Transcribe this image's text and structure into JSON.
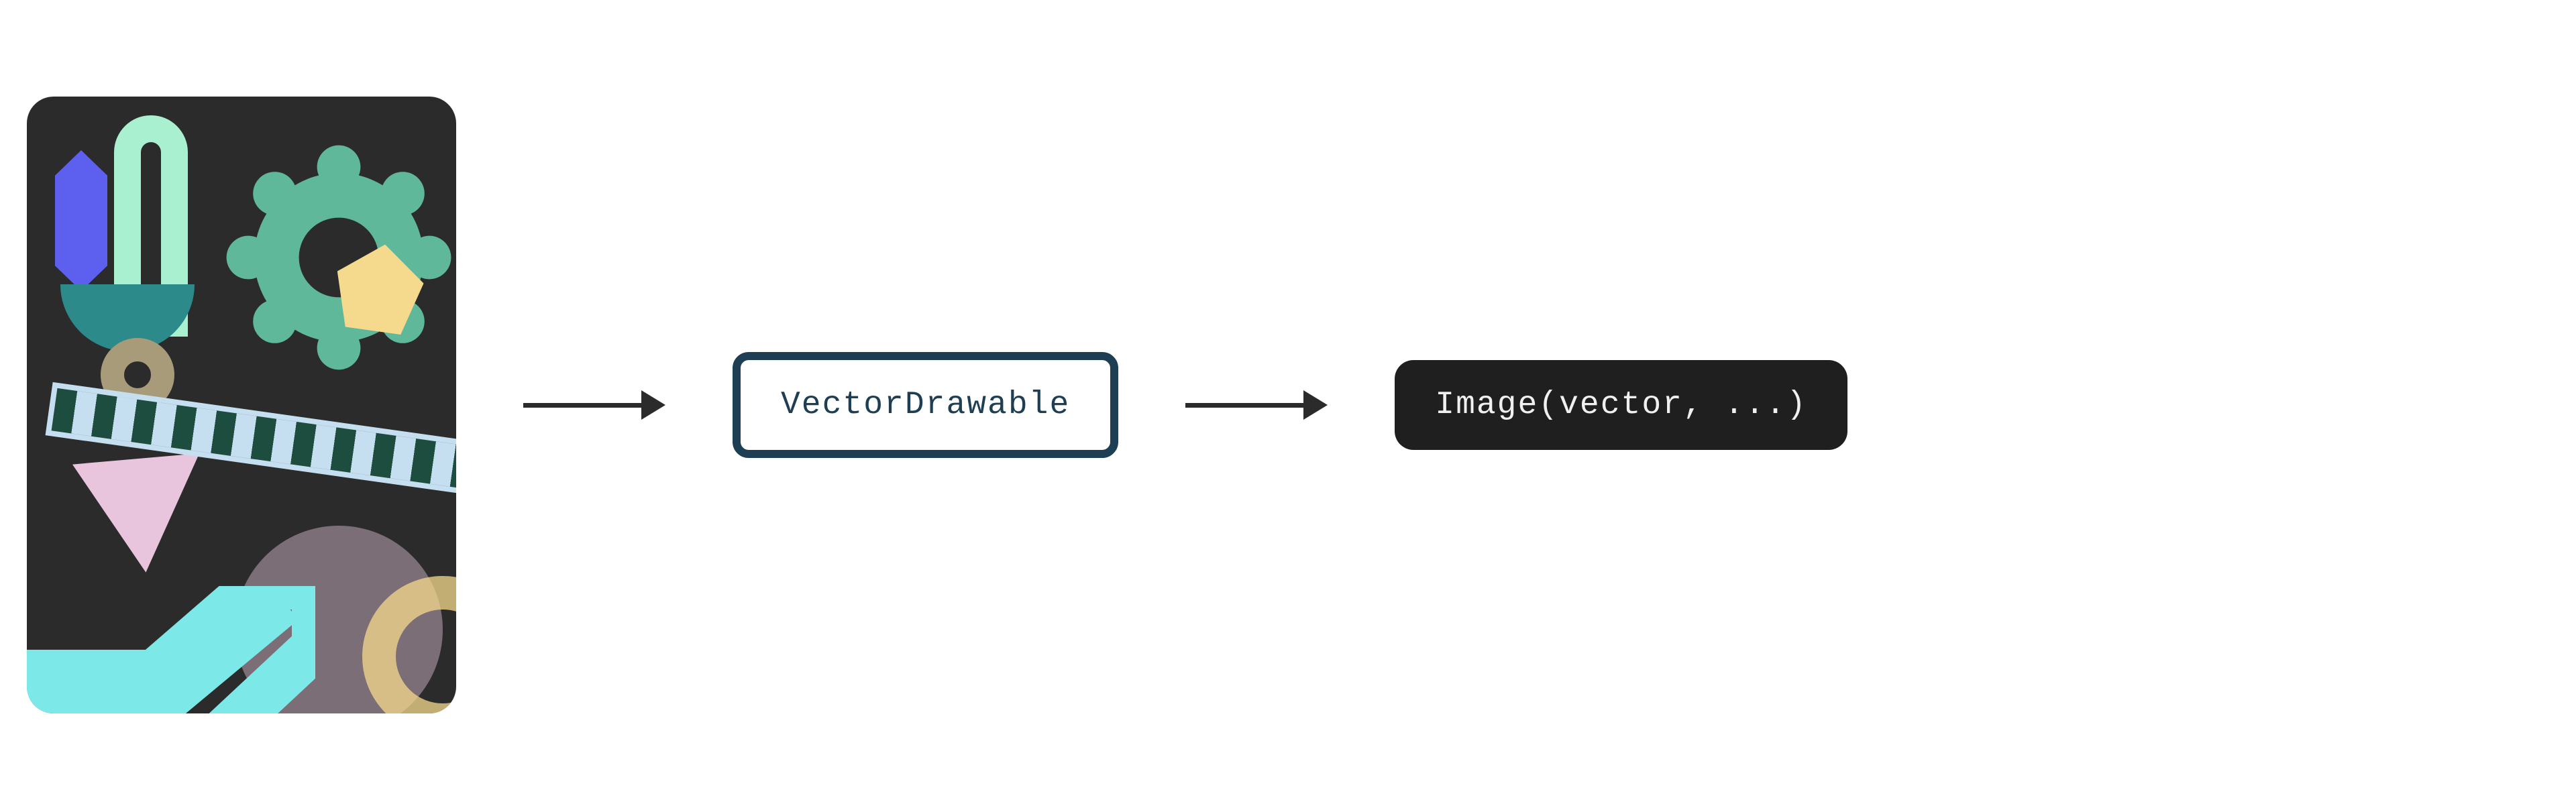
{
  "diagram": {
    "vector_drawable_label": "VectorDrawable",
    "image_call_label": "Image(vector, ...)"
  },
  "colors": {
    "card_bg": "#2b2b2b",
    "arrow": "#2b2b2b",
    "vector_border": "#1d3e53",
    "vector_text": "#1d3e53",
    "code_bg": "#1f1f1f",
    "code_text": "#f0f0f0"
  }
}
